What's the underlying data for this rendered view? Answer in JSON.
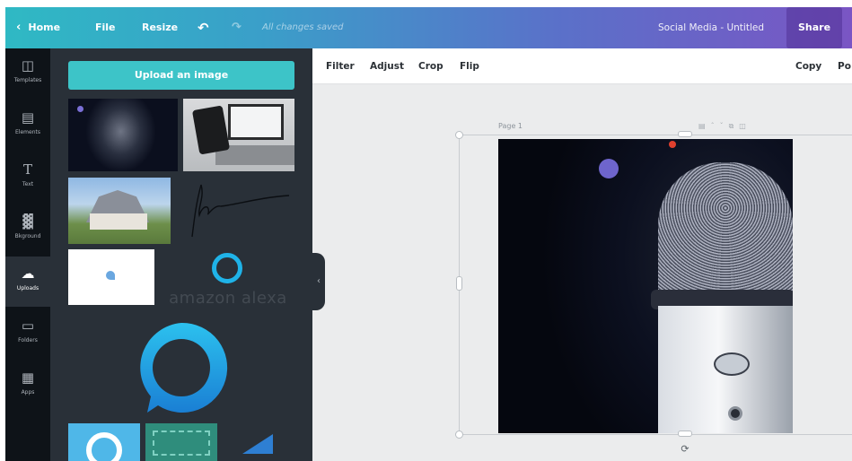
{
  "topbar": {
    "home": "Home",
    "file": "File",
    "resize": "Resize",
    "saved": "All changes saved",
    "title": "Social Media - Untitled",
    "share": "Share"
  },
  "rail": [
    {
      "label": "Templates",
      "icon": "templates-icon"
    },
    {
      "label": "Elements",
      "icon": "elements-icon"
    },
    {
      "label": "Text",
      "icon": "text-icon"
    },
    {
      "label": "Bkground",
      "icon": "background-icon"
    },
    {
      "label": "Uploads",
      "icon": "uploads-icon",
      "active": true
    },
    {
      "label": "Folders",
      "icon": "folder-icon"
    },
    {
      "label": "Apps",
      "icon": "apps-icon"
    }
  ],
  "panel": {
    "upload_button": "Upload an image",
    "alexa_wordmark": "amazon alexa"
  },
  "toolbar": {
    "filter": "Filter",
    "adjust": "Adjust",
    "crop": "Crop",
    "flip": "Flip",
    "copy": "Copy",
    "position": "Po"
  },
  "canvas": {
    "page_label": "Page 1"
  },
  "colors": {
    "accent": "#3dc4c8",
    "panel": "#293038",
    "rail": "#0e1318"
  }
}
